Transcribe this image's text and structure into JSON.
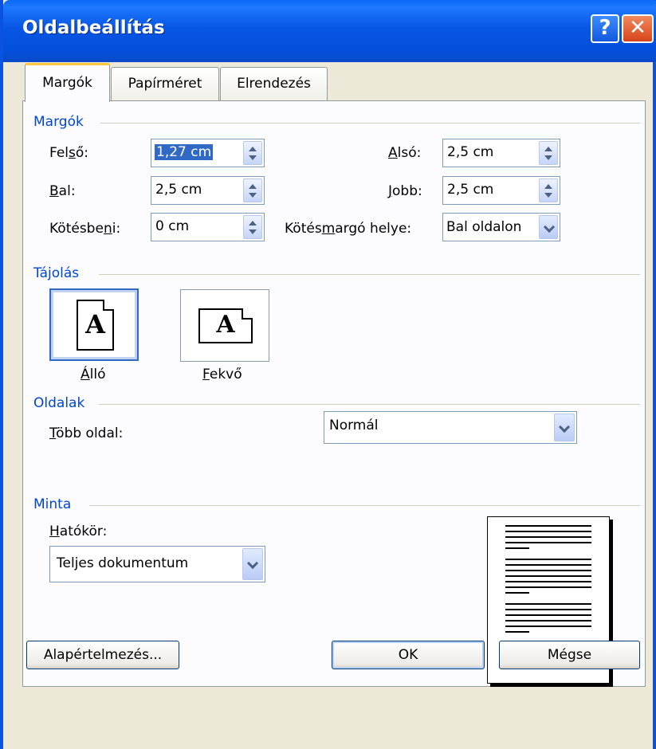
{
  "window": {
    "title": "Oldalbeállítás",
    "help_glyph": "?",
    "close_glyph": "✕"
  },
  "tabs": [
    "Margók",
    "Papírméret",
    "Elrendezés"
  ],
  "margins": {
    "group_title": "Margók",
    "top": {
      "label_pre": "Fel",
      "label_u": "s",
      "label_post": "ő:",
      "value": "1,27 cm"
    },
    "left": {
      "label_pre": "",
      "label_u": "B",
      "label_post": "al:",
      "value": "2,5 cm"
    },
    "gutter": {
      "label_pre": "Kötésbe",
      "label_u": "n",
      "label_post": "i:",
      "value": "0 cm"
    },
    "bottom": {
      "label_pre": "",
      "label_u": "A",
      "label_post": "lsó:",
      "value": "2,5 cm"
    },
    "right": {
      "label_pre": "",
      "label_u": "J",
      "label_post": "obb:",
      "value": "2,5 cm"
    },
    "gutter_pos": {
      "label_pre": "Kötés",
      "label_u": "m",
      "label_post": "argó helye:",
      "value": "Bal oldalon"
    }
  },
  "orientation": {
    "group_title": "Tájolás",
    "portrait": {
      "label_u": "Á",
      "label_post": "lló",
      "glyph": "A"
    },
    "landscape": {
      "label_u": "F",
      "label_post": "ekvő",
      "glyph": "A"
    }
  },
  "pages": {
    "group_title": "Oldalak",
    "label_pre": "",
    "label_u": "T",
    "label_post": "öbb oldal:",
    "value": "Normál"
  },
  "preview": {
    "group_title": "Minta",
    "apply_label_pre": "",
    "apply_label_u": "H",
    "apply_label_post": "atókör:",
    "apply_value": "Teljes dokumentum"
  },
  "buttons": {
    "default": "Alapértelmezés...",
    "ok": "OK",
    "cancel": "Mégse"
  },
  "colors": {
    "title_bar": "#0a53e0",
    "group_title": "#0046d5",
    "selection": "#316ac5",
    "active_tab_accent": "#ffc73c"
  }
}
